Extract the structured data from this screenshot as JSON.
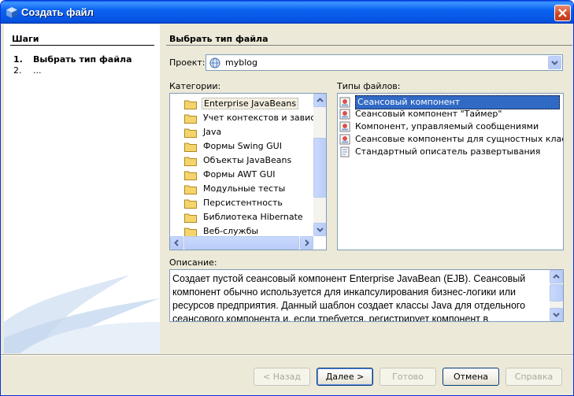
{
  "window": {
    "title": "Создать файл"
  },
  "steps": {
    "title": "Шаги",
    "items": [
      {
        "num": "1.",
        "label": "Выбрать тип файла"
      },
      {
        "num": "2.",
        "label": "..."
      }
    ]
  },
  "main": {
    "title": "Выбрать тип файла",
    "project_label": "Проект:",
    "project_value": "myblog",
    "categories_label": "Категории:",
    "file_types_label": "Типы файлов:",
    "categories": [
      "Enterprise JavaBeans",
      "Учет контекстов и зависим",
      "Java",
      "Формы Swing GUI",
      "Объекты JavaBeans",
      "Формы AWT GUI",
      "Модульные тесты",
      "Персистентность",
      "Библиотека Hibernate",
      "Веб-службы"
    ],
    "file_types": [
      "Сеансовый компонент",
      "Сеансовый компонент \"Таймер\"",
      "Компонент, управляемый сообщениями",
      "Сеансовые компоненты для сущностных классов",
      "Стандартный описатель развертывания"
    ],
    "description_label": "Описание:",
    "description": "Создает пустой сеансовый компонент Enterprise JavaBean (EJB). Сеансовый компонент обычно используется для инкапсулирования бизнес-логики или ресурсов предприятия. Данный шаблон создает классы Java для отдельного сеансового компонента и, если требуется, регистрирует компонент в"
  },
  "buttons": {
    "back": "< Назад",
    "next": "Далее >",
    "finish": "Готово",
    "cancel": "Отмена",
    "help": "Справка"
  },
  "colors": {
    "titlebar": "#0a62f0",
    "selection": "#316ac5",
    "dialog_bg": "#ece9d8"
  }
}
